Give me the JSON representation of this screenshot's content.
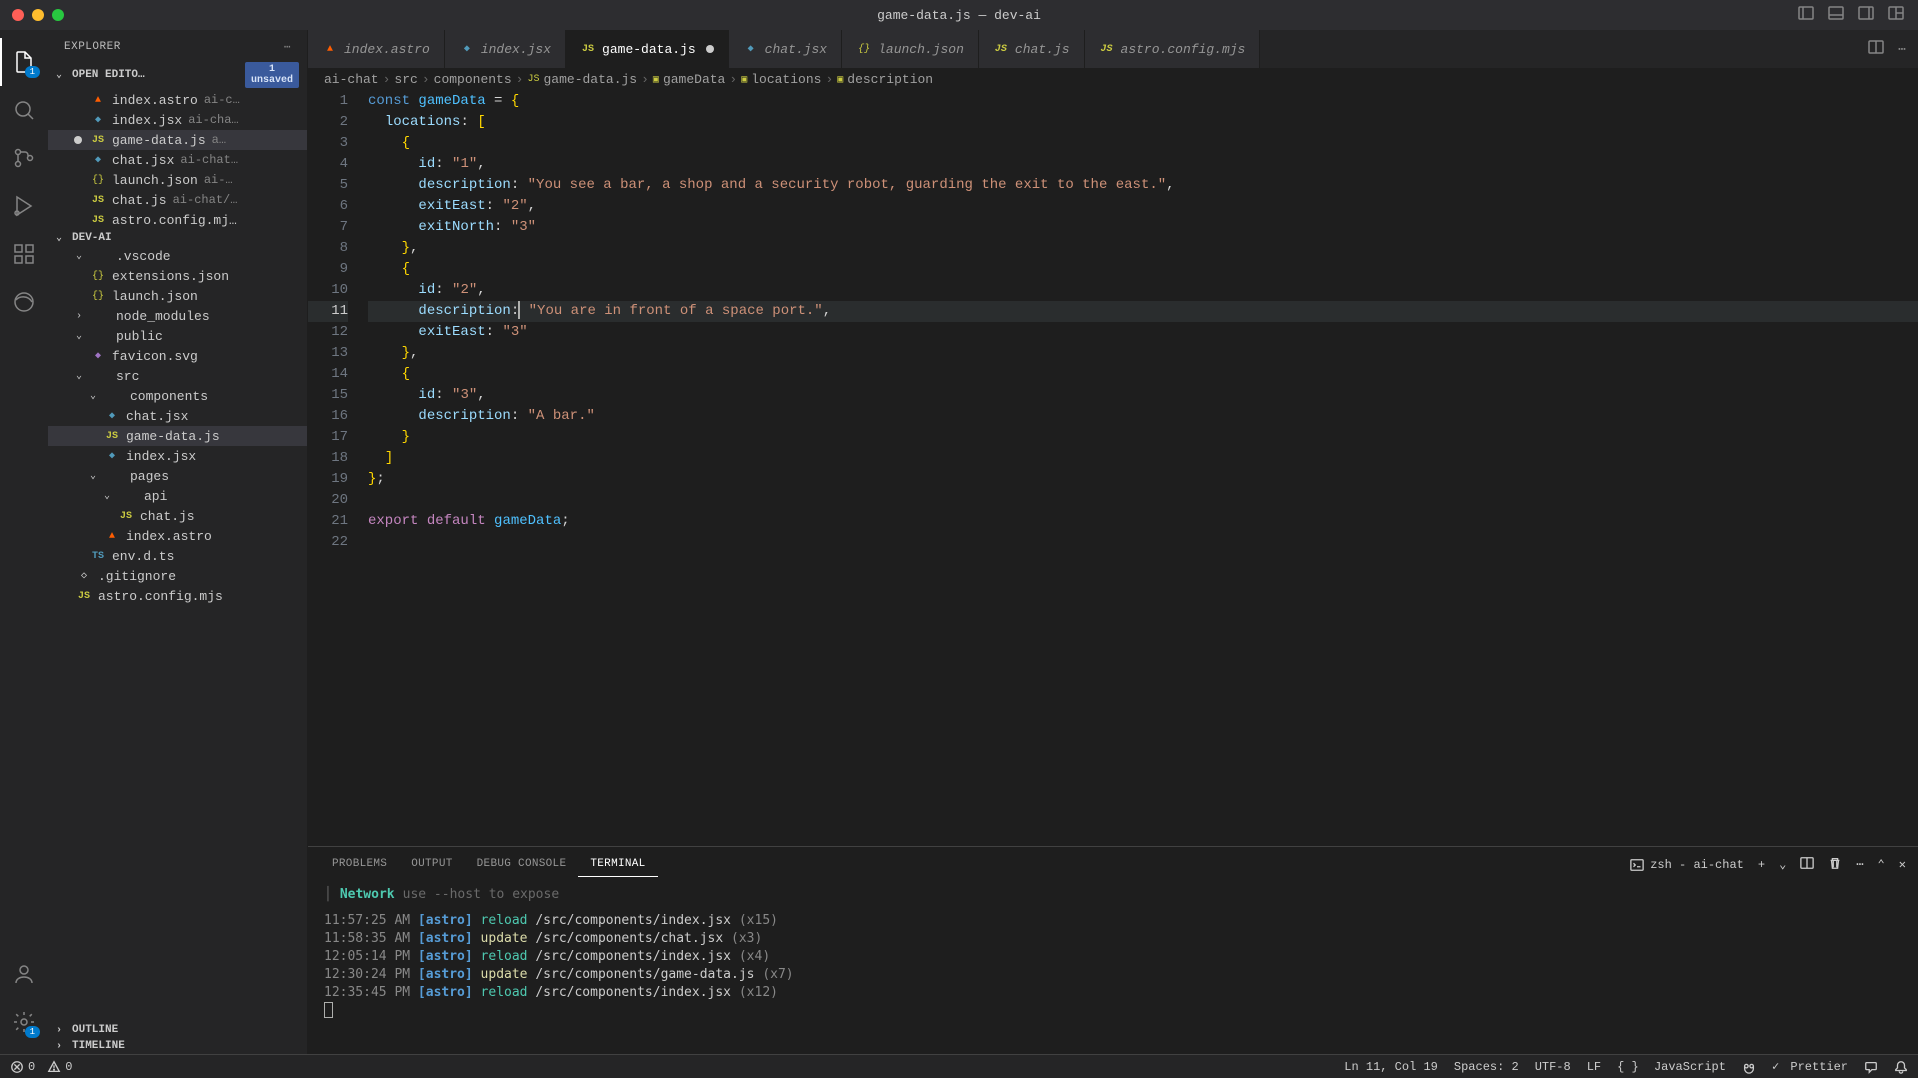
{
  "window": {
    "title": "game-data.js — dev-ai"
  },
  "explorer": {
    "title": "EXPLORER",
    "openEditors": {
      "label": "OPEN EDITO…",
      "unsaved_count": "1",
      "unsaved_label": "unsaved",
      "items": [
        {
          "name": "index.astro",
          "path": "ai-c…",
          "icon": "astro"
        },
        {
          "name": "index.jsx",
          "path": "ai-cha…",
          "icon": "jsx"
        },
        {
          "name": "game-data.js",
          "path": "a…",
          "icon": "js",
          "dirty": true
        },
        {
          "name": "chat.jsx",
          "path": "ai-chat…",
          "icon": "jsx"
        },
        {
          "name": "launch.json",
          "path": "ai-…",
          "icon": "json"
        },
        {
          "name": "chat.js",
          "path": "ai-chat/…",
          "icon": "js"
        },
        {
          "name": "astro.config.mj…",
          "path": "",
          "icon": "js"
        }
      ]
    },
    "workspace": {
      "label": "DEV-AI",
      "tree": [
        {
          "name": ".vscode",
          "type": "folder",
          "depth": 1,
          "open": true
        },
        {
          "name": "extensions.json",
          "type": "json",
          "depth": 2
        },
        {
          "name": "launch.json",
          "type": "json",
          "depth": 2
        },
        {
          "name": "node_modules",
          "type": "folder",
          "depth": 1,
          "open": false
        },
        {
          "name": "public",
          "type": "folder",
          "depth": 1,
          "open": true
        },
        {
          "name": "favicon.svg",
          "type": "svg",
          "depth": 2
        },
        {
          "name": "src",
          "type": "folder",
          "depth": 1,
          "open": true
        },
        {
          "name": "components",
          "type": "folder",
          "depth": 2,
          "open": true
        },
        {
          "name": "chat.jsx",
          "type": "jsx",
          "depth": 3
        },
        {
          "name": "game-data.js",
          "type": "js",
          "depth": 3,
          "active": true
        },
        {
          "name": "index.jsx",
          "type": "jsx",
          "depth": 3
        },
        {
          "name": "pages",
          "type": "folder",
          "depth": 2,
          "open": true
        },
        {
          "name": "api",
          "type": "folder",
          "depth": 3,
          "open": true
        },
        {
          "name": "chat.js",
          "type": "js",
          "depth": 4
        },
        {
          "name": "index.astro",
          "type": "astro",
          "depth": 3
        },
        {
          "name": "env.d.ts",
          "type": "ts",
          "depth": 2
        },
        {
          "name": ".gitignore",
          "type": "file",
          "depth": 1
        },
        {
          "name": "astro.config.mjs",
          "type": "js",
          "depth": 1
        }
      ]
    },
    "outline": "OUTLINE",
    "timeline": "TIMELINE"
  },
  "tabs": [
    {
      "label": "index.astro",
      "icon": "astro"
    },
    {
      "label": "index.jsx",
      "icon": "jsx"
    },
    {
      "label": "game-data.js",
      "icon": "js",
      "active": true,
      "dirty": true
    },
    {
      "label": "chat.jsx",
      "icon": "jsx"
    },
    {
      "label": "launch.json",
      "icon": "json"
    },
    {
      "label": "chat.js",
      "icon": "js"
    },
    {
      "label": "astro.config.mjs",
      "icon": "js"
    }
  ],
  "breadcrumbs": [
    "ai-chat",
    "src",
    "components",
    "game-data.js",
    "gameData",
    "locations",
    "description"
  ],
  "code": {
    "lines": [
      {
        "n": 1,
        "html": "<span class='tok-const'>const</span> <span class='tok-var'>gameData</span> <span class='tok-punc'>=</span> <span class='tok-brace'>{</span>"
      },
      {
        "n": 2,
        "html": "  <span class='tok-prop'>locations</span><span class='tok-punc'>:</span> <span class='tok-brace'>[</span>"
      },
      {
        "n": 3,
        "html": "    <span class='tok-brace'>{</span>"
      },
      {
        "n": 4,
        "html": "      <span class='tok-prop'>id</span><span class='tok-punc'>:</span> <span class='tok-str'>\"1\"</span><span class='tok-punc'>,</span>"
      },
      {
        "n": 5,
        "html": "      <span class='tok-prop'>description</span><span class='tok-punc'>:</span> <span class='tok-str'>\"You see a bar, a shop and a security robot, guarding the exit to the east.\"</span><span class='tok-punc'>,</span>"
      },
      {
        "n": 6,
        "html": "      <span class='tok-prop'>exitEast</span><span class='tok-punc'>:</span> <span class='tok-str'>\"2\"</span><span class='tok-punc'>,</span>"
      },
      {
        "n": 7,
        "html": "      <span class='tok-prop'>exitNorth</span><span class='tok-punc'>:</span> <span class='tok-str'>\"3\"</span>"
      },
      {
        "n": 8,
        "html": "    <span class='tok-brace'>}</span><span class='tok-punc'>,</span>"
      },
      {
        "n": 9,
        "html": "    <span class='tok-brace'>{</span>"
      },
      {
        "n": 10,
        "html": "      <span class='tok-prop'>id</span><span class='tok-punc'>:</span> <span class='tok-str'>\"2\"</span><span class='tok-punc'>,</span>"
      },
      {
        "n": 11,
        "html": "      <span class='tok-prop'>description</span><span class='tok-punc'>:</span><span class='cursor-line'></span> <span class='tok-str'>\"You are in front of a space port.\"</span><span class='tok-punc'>,</span>",
        "current": true
      },
      {
        "n": 12,
        "html": "      <span class='tok-prop'>exitEast</span><span class='tok-punc'>:</span> <span class='tok-str'>\"3\"</span>"
      },
      {
        "n": 13,
        "html": "    <span class='tok-brace'>}</span><span class='tok-punc'>,</span>"
      },
      {
        "n": 14,
        "html": "    <span class='tok-brace'>{</span>"
      },
      {
        "n": 15,
        "html": "      <span class='tok-prop'>id</span><span class='tok-punc'>:</span> <span class='tok-str'>\"3\"</span><span class='tok-punc'>,</span>"
      },
      {
        "n": 16,
        "html": "      <span class='tok-prop'>description</span><span class='tok-punc'>:</span> <span class='tok-str'>\"A bar.\"</span>"
      },
      {
        "n": 17,
        "html": "    <span class='tok-brace'>}</span>"
      },
      {
        "n": 18,
        "html": "  <span class='tok-brace'>]</span>"
      },
      {
        "n": 19,
        "html": "<span class='tok-brace'>}</span><span class='tok-punc'>;</span>"
      },
      {
        "n": 20,
        "html": ""
      },
      {
        "n": 21,
        "html": "<span class='tok-kw'>export</span> <span class='tok-kw'>default</span> <span class='tok-var'>gameData</span><span class='tok-punc'>;</span>"
      },
      {
        "n": 22,
        "html": ""
      }
    ]
  },
  "panel": {
    "tabs": [
      "PROBLEMS",
      "OUTPUT",
      "DEBUG CONSOLE",
      "TERMINAL"
    ],
    "active": "TERMINAL",
    "shell": "zsh - ai-chat",
    "network_label": "Network",
    "network_hint": "use --host to expose",
    "log": [
      {
        "time": "11:57:25 AM",
        "tag": "[astro]",
        "action": "reload",
        "path": "/src/components/index.jsx",
        "count": "(x15)"
      },
      {
        "time": "11:58:35 AM",
        "tag": "[astro]",
        "action": "update",
        "path": "/src/components/chat.jsx",
        "count": "(x3)"
      },
      {
        "time": "12:05:14 PM",
        "tag": "[astro]",
        "action": "reload",
        "path": "/src/components/index.jsx",
        "count": "(x4)"
      },
      {
        "time": "12:30:24 PM",
        "tag": "[astro]",
        "action": "update",
        "path": "/src/components/game-data.js",
        "count": "(x7)"
      },
      {
        "time": "12:35:45 PM",
        "tag": "[astro]",
        "action": "reload",
        "path": "/src/components/index.jsx",
        "count": "(x12)"
      }
    ]
  },
  "status": {
    "errors": "0",
    "warnings": "0",
    "cursor": "Ln 11, Col 19",
    "spaces": "Spaces: 2",
    "encoding": "UTF-8",
    "eol": "LF",
    "lang": "JavaScript",
    "prettier": "Prettier"
  }
}
